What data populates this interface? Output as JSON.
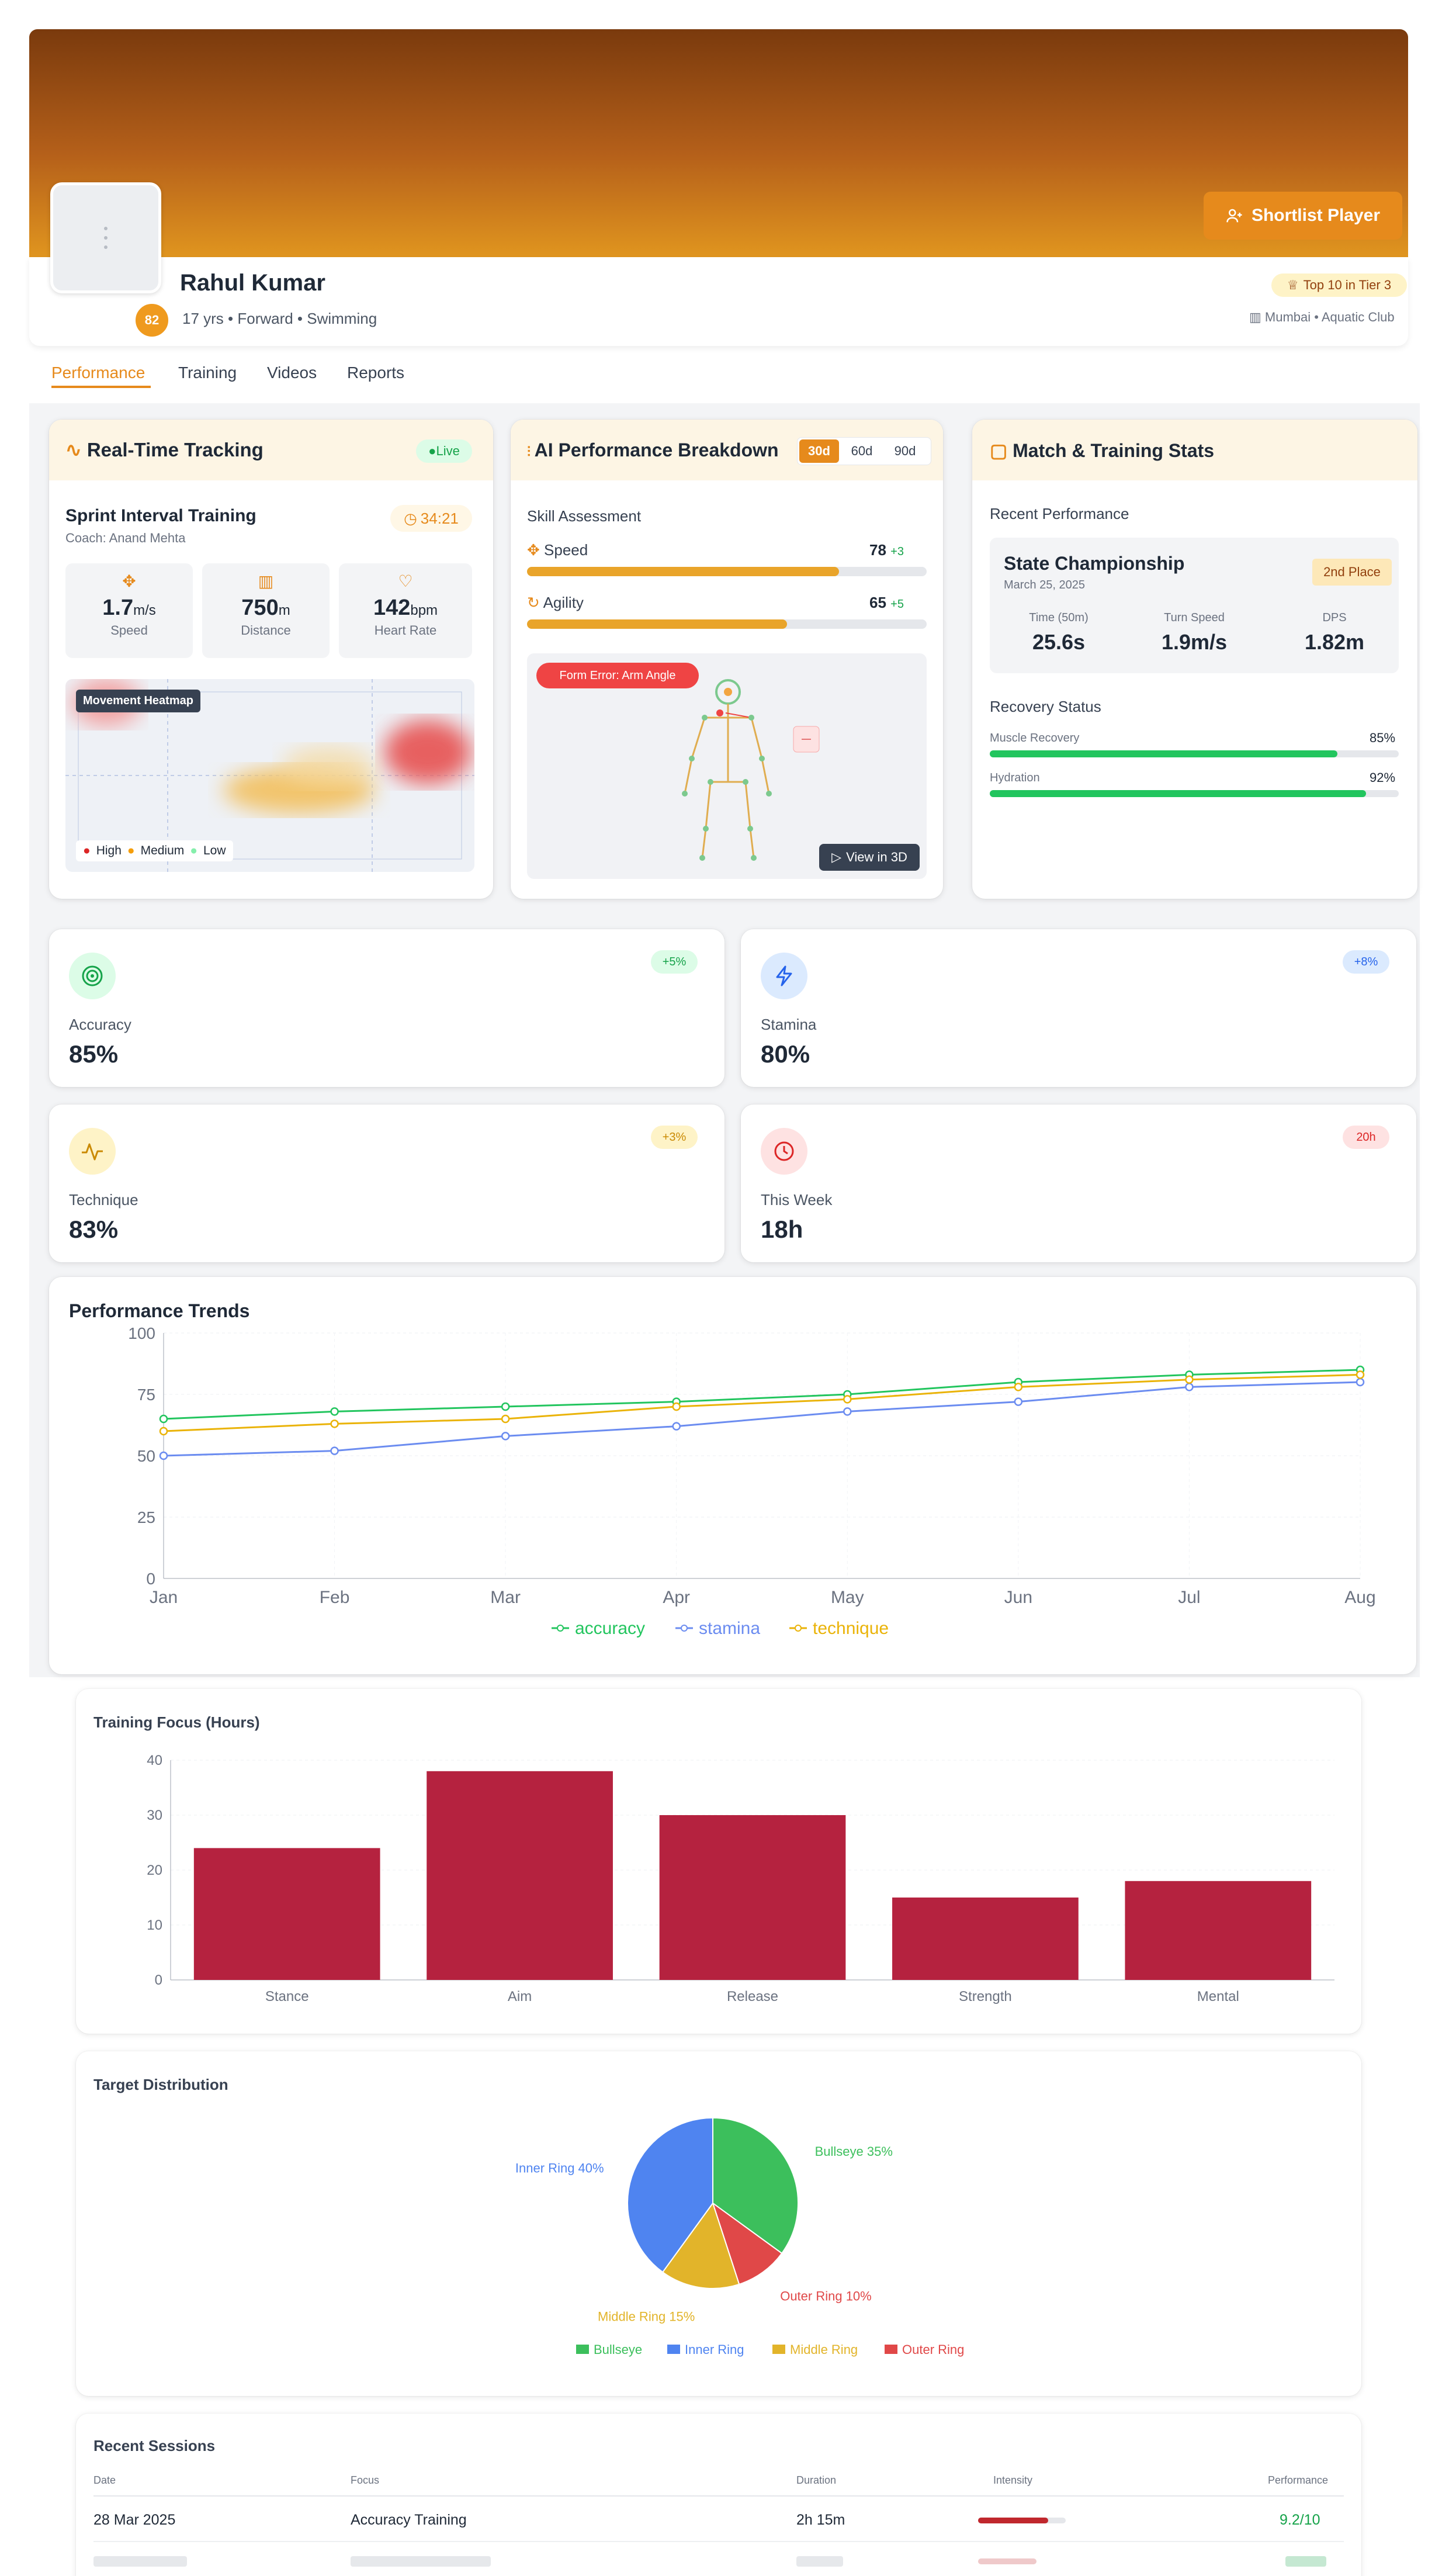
{
  "profile": {
    "name": "Rahul Kumar",
    "meta": "17 yrs • Forward • Swimming",
    "rating": "82",
    "tier_badge": "Top 10 in Tier 3",
    "location": "Mumbai • Aquatic Club",
    "shortlist_label": "Shortlist Player"
  },
  "tabs": [
    "Performance",
    "Training",
    "Videos",
    "Reports"
  ],
  "tracking": {
    "title": "Real-Time Tracking",
    "live": "Live",
    "session": "Sprint Interval Training",
    "coach": "Coach: Anand Mehta",
    "timer": "34:21",
    "metrics": [
      {
        "value": "1.7",
        "unit": "m/s",
        "label": "Speed"
      },
      {
        "value": "750",
        "unit": "m",
        "label": "Distance"
      },
      {
        "value": "142",
        "unit": "bpm",
        "label": "Heart Rate"
      }
    ],
    "heatmap_label": "Movement Heatmap",
    "legend": [
      "High",
      "Medium",
      "Low"
    ]
  },
  "ai": {
    "title": "AI Performance Breakdown",
    "ranges": [
      "30d",
      "60d",
      "90d"
    ],
    "skill_title": "Skill Assessment",
    "skills": [
      {
        "name": "Speed",
        "score": "78",
        "delta": "+3",
        "pct": 78
      },
      {
        "name": "Agility",
        "score": "65",
        "delta": "+5",
        "pct": 65
      }
    ],
    "form_error": "Form Error: Arm Angle",
    "view3d": "View in 3D"
  },
  "match": {
    "title": "Match & Training Stats",
    "recent_title": "Recent Performance",
    "event": "State Championship",
    "date": "March 25, 2025",
    "place": "2nd Place",
    "stats": [
      {
        "label": "Time (50m)",
        "value": "25.6s"
      },
      {
        "label": "Turn Speed",
        "value": "1.9m/s"
      },
      {
        "label": "DPS",
        "value": "1.82m"
      }
    ],
    "recovery_title": "Recovery Status",
    "recovery": [
      {
        "label": "Muscle Recovery",
        "value": "85%",
        "pct": 85
      },
      {
        "label": "Hydration",
        "value": "92%",
        "pct": 92
      }
    ]
  },
  "kpis": [
    {
      "label": "Accuracy",
      "value": "85%",
      "badge": "+5%",
      "icon": "target-icon",
      "color": "#16a34a",
      "bg": "#dcfce7"
    },
    {
      "label": "Stamina",
      "value": "80%",
      "badge": "+8%",
      "icon": "lightning-icon",
      "color": "#2563eb",
      "bg": "#dbeafe"
    },
    {
      "label": "Technique",
      "value": "83%",
      "badge": "+3%",
      "icon": "activity-icon",
      "color": "#ca8a04",
      "bg": "#fef3c7"
    },
    {
      "label": "This Week",
      "value": "18h",
      "badge": "20h",
      "icon": "clock-icon",
      "color": "#dc2626",
      "bg": "#fee2e2"
    }
  ],
  "trends": {
    "title": "Performance Trends",
    "chart_data": {
      "type": "line",
      "categories": [
        "Jan",
        "Feb",
        "Mar",
        "Apr",
        "May",
        "Jun",
        "Jul",
        "Aug"
      ],
      "ylim": [
        0,
        100
      ],
      "yticks": [
        0,
        25,
        50,
        75,
        100
      ],
      "series": [
        {
          "name": "accuracy",
          "color": "#22c55e",
          "values": [
            65,
            68,
            70,
            72,
            75,
            80,
            83,
            85
          ]
        },
        {
          "name": "stamina",
          "color": "#6b8cf0",
          "values": [
            50,
            52,
            58,
            62,
            68,
            72,
            78,
            80
          ]
        },
        {
          "name": "technique",
          "color": "#eab308",
          "values": [
            60,
            63,
            65,
            70,
            73,
            78,
            81,
            83
          ]
        }
      ]
    }
  },
  "focus": {
    "title": "Training Focus (Hours)",
    "chart_data": {
      "type": "bar",
      "categories": [
        "Stance",
        "Aim",
        "Release",
        "Strength",
        "Mental"
      ],
      "values": [
        24,
        38,
        30,
        15,
        18
      ],
      "ylim": [
        0,
        40
      ],
      "yticks": [
        0,
        10,
        20,
        30,
        40
      ],
      "color": "#b5223f"
    }
  },
  "target": {
    "title": "Target Distribution",
    "chart_data": {
      "type": "pie",
      "slices": [
        {
          "name": "Bullseye",
          "value": 35,
          "label": "Bullseye 35%",
          "color": "#3cbf5c"
        },
        {
          "name": "Outer Ring",
          "value": 10,
          "label": "Outer Ring 10%",
          "color": "#e04848"
        },
        {
          "name": "Middle Ring",
          "value": 15,
          "label": "Middle Ring 15%",
          "color": "#e2b42a"
        },
        {
          "name": "Inner Ring",
          "value": 40,
          "label": "Inner Ring 40%",
          "color": "#4f84f0"
        }
      ],
      "legend": [
        "Bullseye",
        "Inner Ring",
        "Middle Ring",
        "Outer Ring"
      ]
    }
  },
  "sessions": {
    "title": "Recent Sessions",
    "headers": [
      "Date",
      "Focus",
      "Duration",
      "Intensity",
      "Performance"
    ],
    "rows": [
      {
        "date": "28 Mar 2025",
        "focus": "Accuracy Training",
        "duration": "2h 15m",
        "intensity": 0.8,
        "performance": "9.2/10"
      }
    ]
  }
}
